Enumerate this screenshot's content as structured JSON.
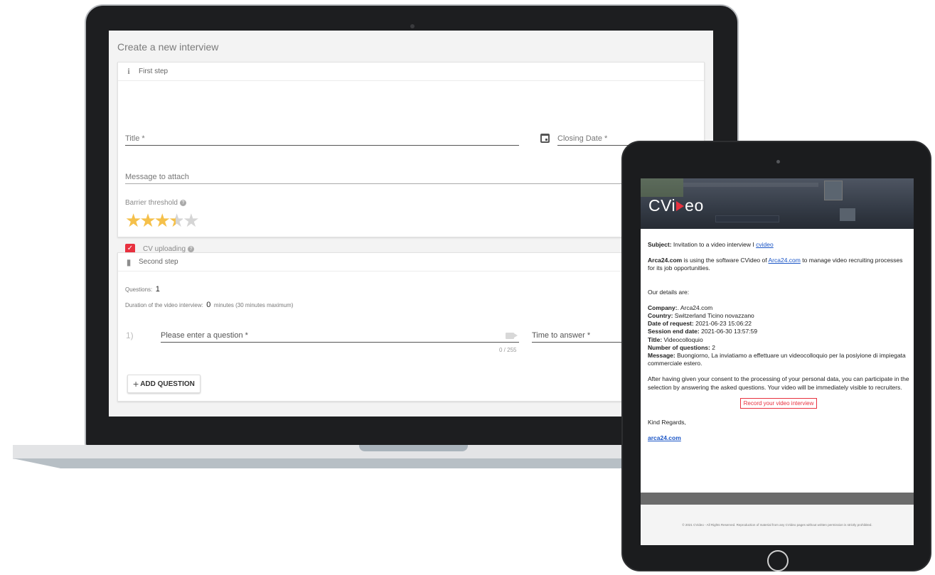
{
  "laptop": {
    "page_title": "Create a new interview",
    "first_step": {
      "header": "First step",
      "title_placeholder": "Title *",
      "closing_date_placeholder": "Closing Date *",
      "message_placeholder": "Message to attach",
      "barrier_label": "Barrier threshold",
      "barrier_rating": 3.5,
      "barrier_max": 5,
      "cv_uploading_label": "CV uploading",
      "cv_uploading_checked": true
    },
    "second_step": {
      "header": "Second step",
      "questions_label": "Questions:",
      "questions_count": "1",
      "duration_label": "Duration of the video interview:",
      "duration_value": "0",
      "duration_suffix": "minutes (30 minutes maximum)",
      "question_number": "1)",
      "question_placeholder": "Please enter a question *",
      "char_counter": "0 / 255",
      "time_placeholder": "Time to answer *",
      "add_question_label": "ADD QUESTION"
    }
  },
  "email": {
    "logo_left": "CVi",
    "logo_right": "eo",
    "subject_label": "Subject:",
    "subject_text": "Invitation to a video interview I",
    "subject_link": "cvideo",
    "intro_bold": "Arca24.com",
    "intro_text_1": "is using the software CVideo of",
    "intro_link": "Arca24.com",
    "intro_text_2": "to manage video recruiting processes for its job opportunities.",
    "details_heading": "Our details are:",
    "company_label": "Company:",
    "company_value": ". Arca24.com",
    "country_label": "Country:",
    "country_value": "Switzerland Ticino novazzano",
    "request_label": "Date of request:",
    "request_value": "2021-06-23 15:06:22",
    "session_label": "Session end date:",
    "session_value": "2021-06-30 13:57:59",
    "title_label": "Title:",
    "title_value": "Videocolloquio",
    "num_q_label": "Number of questions:",
    "num_q_value": "2",
    "message_label": "Message:",
    "message_value": "Buongiorno, La inviatiamo a effettuare un videocolloquio per la posiyione di impiegata commerciale estero.",
    "consent_text": "After having given your consent to the processing of your personal data, you can participate in the selection by answering the asked questions. Your video will be immediately visible to recruiters.",
    "record_button": "Record your video interview",
    "regards": "Kind Regards,",
    "signature_link": "arca24.com",
    "footer": "© 2021 CVideo - All Rights Reserved. Reproduction of material from any CVideo pages without written permission is strictly prohibited."
  },
  "colors": {
    "accent": "#e8313f",
    "star": "#f5c04a",
    "link": "#1a55c6"
  }
}
